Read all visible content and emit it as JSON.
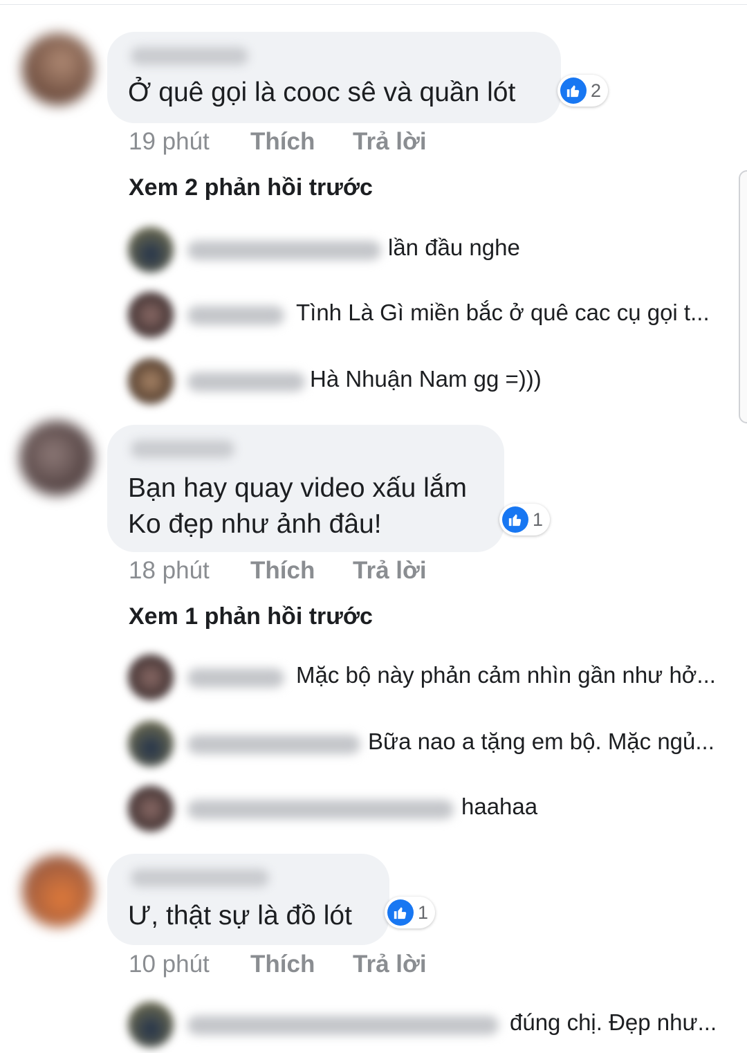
{
  "comments": [
    {
      "text": "Ở quê gọi là cooc sê và quần lót",
      "likes": "2",
      "time": "19 phút",
      "like_label": "Thích",
      "reply_label": "Trả lời",
      "view_previous": "Xem 2 phản hồi trước",
      "replies": [
        {
          "text": "lần đầu nghe"
        },
        {
          "text": "Tình Là Gì miền bắc ở quê cac cụ gọi t..."
        },
        {
          "text": "Hà Nhuận Nam  gg =)))"
        }
      ]
    },
    {
      "text": "Bạn hay quay video xấu lắm\nKo đẹp như ảnh đâu!",
      "likes": "1",
      "time": "18 phút",
      "like_label": "Thích",
      "reply_label": "Trả lời",
      "view_previous": "Xem 1 phản hồi trước",
      "replies": [
        {
          "text": "Mặc bộ này phản cảm nhìn gần như hở..."
        },
        {
          "text": "Bữa nao a tặng em bộ. Mặc ngủ..."
        },
        {
          "text": "haahaa"
        }
      ]
    },
    {
      "text": "Ư, thật sự là đồ lót",
      "likes": "1",
      "time": "10 phút",
      "like_label": "Thích",
      "reply_label": "Trả lời",
      "replies": [
        {
          "text": "đúng chị. Đẹp như..."
        }
      ]
    }
  ],
  "colors": {
    "bubble": "#f0f2f5",
    "like_blue": "#1877f2",
    "meta_gray": "#8a8d91"
  },
  "icons": {
    "like": "thumbs-up-icon"
  }
}
